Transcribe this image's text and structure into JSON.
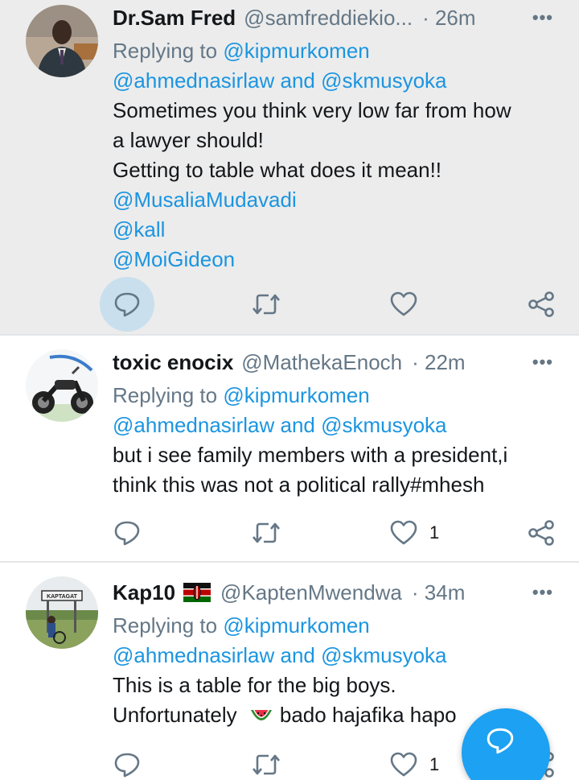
{
  "tweets": [
    {
      "name": "Dr.Sam Fred",
      "handle": "@samfreddiekio...",
      "time": "· 26m",
      "more": "•••",
      "lines": [
        [
          "Replying to ",
          "@kipmurkomen"
        ],
        [
          "@ahmednasirlaw and @skmusyoka"
        ],
        [
          "Sometimes you think very low far from how"
        ],
        [
          "a lawyer should!"
        ],
        [
          "Getting to table what does it mean!!"
        ],
        [
          "@MusaliaMudavadi"
        ],
        [
          "@kall"
        ],
        [
          "@MoiGideon"
        ]
      ],
      "like_count": ""
    },
    {
      "name": "toxic enocix",
      "handle": "@MathekaEnoch",
      "time": "· 22m",
      "more": "•••",
      "lines": [
        [
          "Replying to ",
          "@kipmurkomen"
        ],
        [
          "@ahmednasirlaw and @skmusyoka"
        ],
        [
          "but i see family members with a president,i"
        ],
        [
          "think this was not a political rally#mhesh"
        ]
      ],
      "like_count": "1"
    },
    {
      "name": "Kap10",
      "name_emoji": "kenya-flag",
      "handle": "@KaptenMwendwa",
      "time": "· 34m",
      "more": "•••",
      "lines": [
        [
          "Replying to ",
          "@kipmurkomen"
        ],
        [
          "@ahmednasirlaw and @skmusyoka"
        ],
        [
          "This is a table for the big boys."
        ],
        [
          "Unfortunately ",
          "bado hajafika hapo"
        ]
      ],
      "line4_emoji": "watermelon",
      "like_count": "1"
    }
  ],
  "colors": {
    "link": "#1b95e0",
    "secondary": "#657786",
    "highlight_bg": "#ececec",
    "fab": "#1da1f2"
  },
  "icons": [
    "reply-icon",
    "retweet-icon",
    "like-icon",
    "share-icon",
    "compose-reply-icon"
  ]
}
